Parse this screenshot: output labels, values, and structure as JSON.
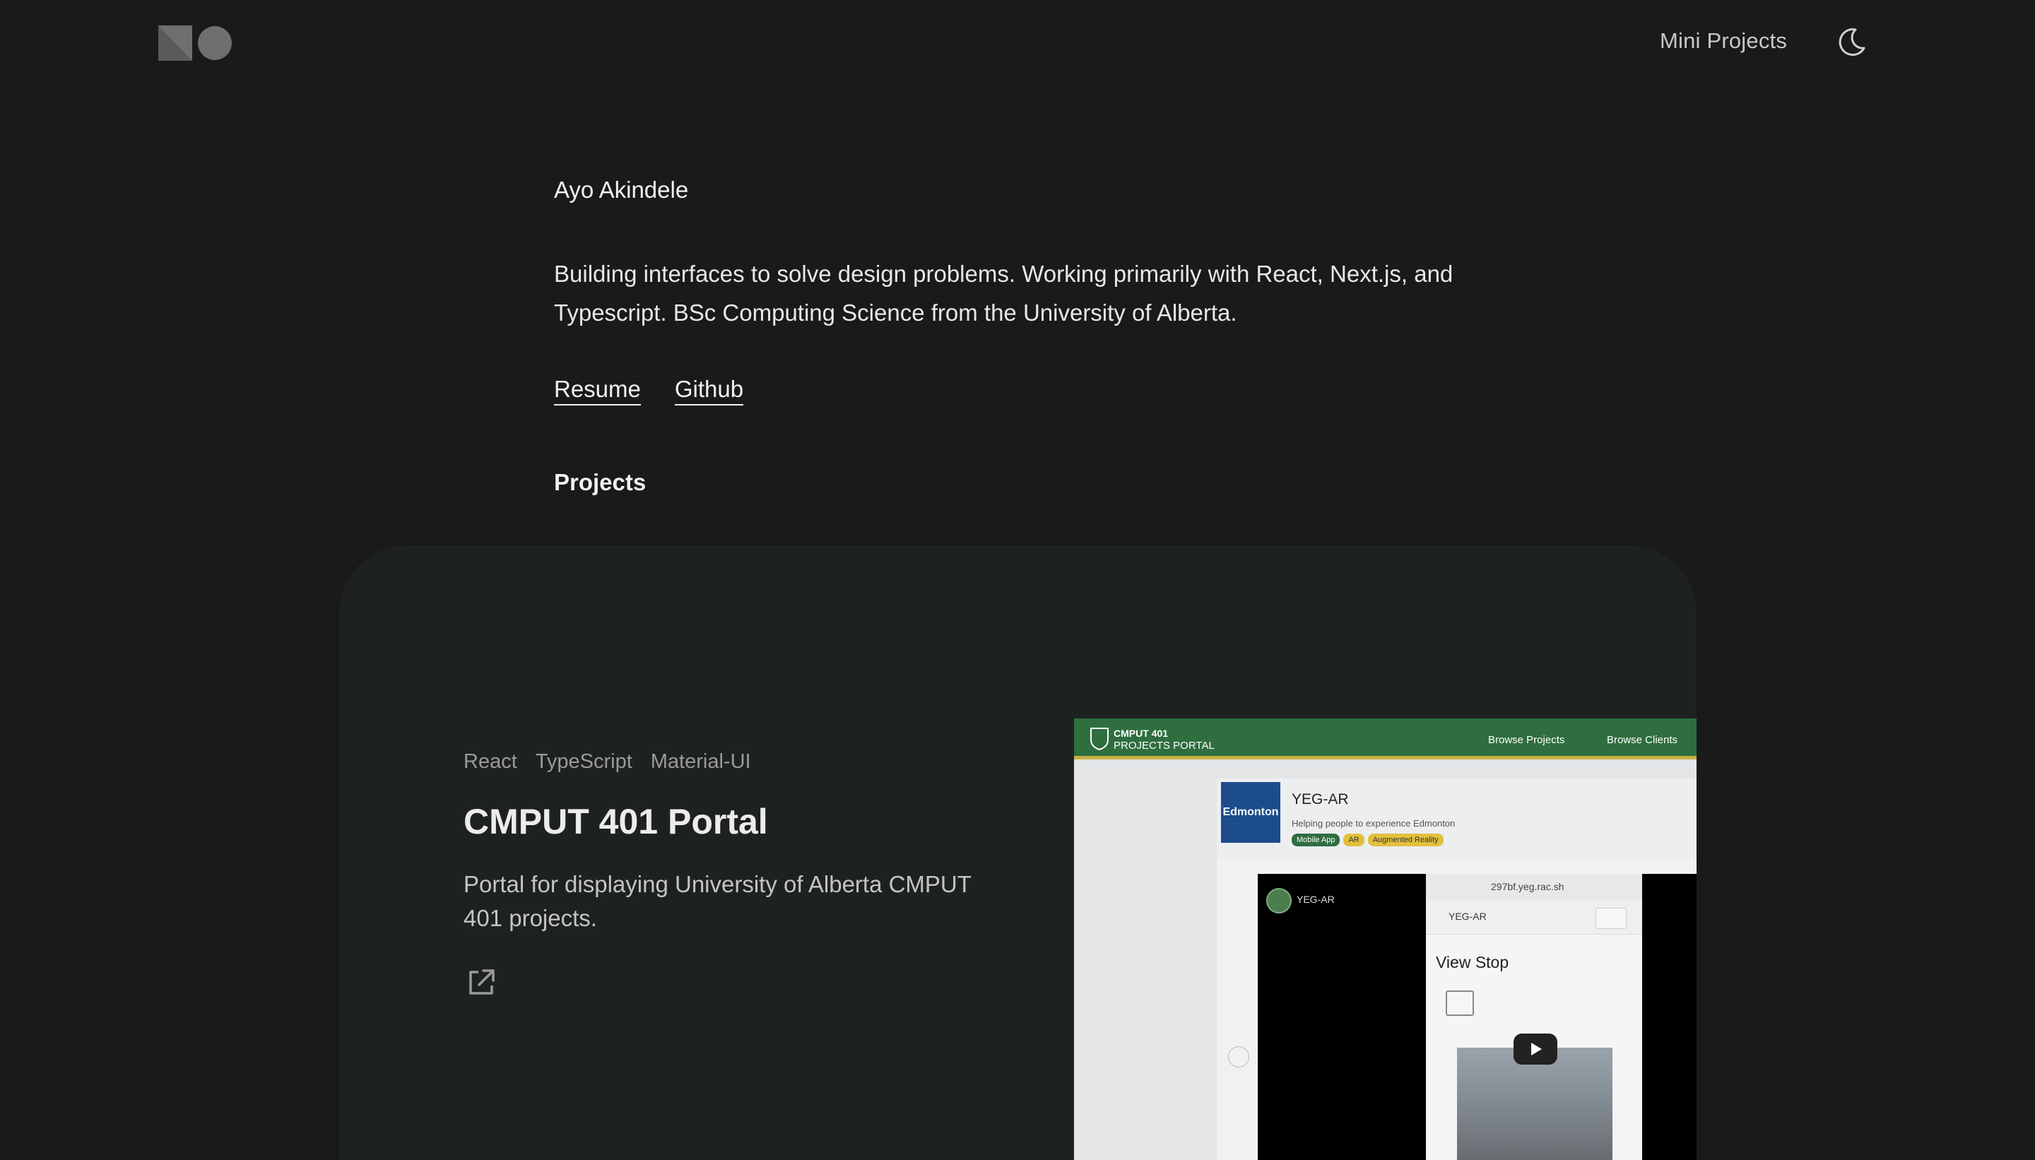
{
  "header": {
    "nav_link": "Mini Projects",
    "logo_icon": "logo-square-circle-icon",
    "theme_icon": "moon-icon"
  },
  "intro": {
    "name": "Ayo Akindele",
    "bio": "Building interfaces to solve design problems. Working primarily with React, Next.js, and Typescript. BSc Computing Science from the University of Alberta.",
    "links": [
      "Resume",
      "Github"
    ]
  },
  "projects": {
    "section_title": "Projects",
    "items": [
      {
        "tags": [
          "React",
          "TypeScript",
          "Material-UI"
        ],
        "title": "CMPUT 401 Portal",
        "description": "Portal for displaying University of Alberta CMPUT 401 projects.",
        "link_icon": "external-link-icon",
        "screenshot": {
          "brand_title": "CMPUT 401",
          "brand_subtitle": "PROJECTS PORTAL",
          "nav": [
            "Browse Projects",
            "Browse Clients"
          ],
          "logo_text": "Edmonton",
          "project_name": "YEG-AR",
          "project_tagline": "Helping people to experience Edmonton",
          "pills": [
            "Mobile App",
            "AR",
            "Augmented Reality"
          ],
          "video_channel": "YEG-AR",
          "url": "297bf.yeg.rac.sh",
          "app_title": "YEG-AR",
          "page_heading": "View Stop",
          "back_label": "←"
        }
      }
    ]
  },
  "colors": {
    "background": "#1a1a1a",
    "card": "#1e221f",
    "portal_green": "#2f6e3f",
    "portal_gold": "#c8b043"
  }
}
